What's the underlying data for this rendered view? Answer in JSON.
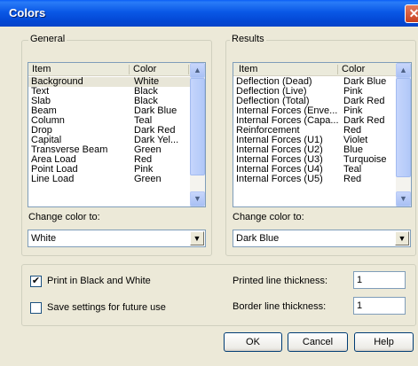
{
  "window": {
    "title": "Colors",
    "close_glyph": "✕"
  },
  "general": {
    "label": "General",
    "columns": [
      "Item",
      "Color"
    ],
    "rows": [
      {
        "item": "Background",
        "color": "White"
      },
      {
        "item": "Text",
        "color": "Black"
      },
      {
        "item": "Slab",
        "color": "Black"
      },
      {
        "item": "Beam",
        "color": "Dark Blue"
      },
      {
        "item": "Column",
        "color": "Teal"
      },
      {
        "item": "Drop",
        "color": "Dark Red"
      },
      {
        "item": "Capital",
        "color": "Dark Yel..."
      },
      {
        "item": "Transverse Beam",
        "color": "Green"
      },
      {
        "item": "Area Load",
        "color": "Red"
      },
      {
        "item": "Point Load",
        "color": "Pink"
      },
      {
        "item": "Line Load",
        "color": "Green"
      }
    ],
    "change_label": "Change color to:",
    "selected_color": "White"
  },
  "results": {
    "label": "Results",
    "columns": [
      "Item",
      "Color"
    ],
    "rows": [
      {
        "item": "Deflection (Dead)",
        "color": "Dark Blue"
      },
      {
        "item": "Deflection (Live)",
        "color": "Pink"
      },
      {
        "item": "Deflection (Total)",
        "color": "Dark Red"
      },
      {
        "item": "Internal Forces (Enve...",
        "color": "Pink"
      },
      {
        "item": "Internal Forces (Capa...",
        "color": "Dark Red"
      },
      {
        "item": "Reinforcement",
        "color": "Red"
      },
      {
        "item": "Internal Forces (U1)",
        "color": "Violet"
      },
      {
        "item": "Internal Forces (U2)",
        "color": "Blue"
      },
      {
        "item": "Internal Forces (U3)",
        "color": "Turquoise"
      },
      {
        "item": "Internal Forces (U4)",
        "color": "Teal"
      },
      {
        "item": "Internal Forces (U5)",
        "color": "Red"
      }
    ],
    "change_label": "Change color to:",
    "selected_color": "Dark Blue"
  },
  "options": {
    "print_bw_label": "Print in Black and White",
    "print_bw_checked": true,
    "save_settings_label": "Save settings for future use",
    "save_settings_checked": false,
    "printed_line_label": "Printed line thickness:",
    "printed_line_value": "1",
    "border_line_label": "Border line thickness:",
    "border_line_value": "1"
  },
  "buttons": {
    "ok": "OK",
    "cancel": "Cancel",
    "help": "Help"
  },
  "glyphs": {
    "check": "✔",
    "up": "▲",
    "down": "▼"
  }
}
